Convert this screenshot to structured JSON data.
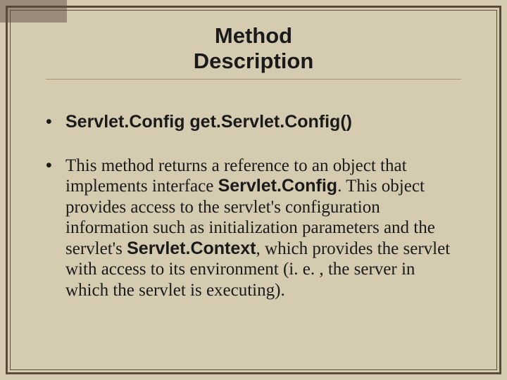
{
  "title_line1": "Method",
  "title_line2": "Description",
  "method_signature": "Servlet.Config get.Servlet.Config()",
  "description": {
    "part1": "This method returns a reference to an object that implements interface ",
    "kw1": "Servlet.Config",
    "part2": ". This object provides access to the servlet's configuration information such as initialization parameters and the servlet's ",
    "kw2": "Servlet.Context",
    "part3": ", which provides the servlet with access to its environment (i. e. , the server in which the servlet is executing)."
  }
}
